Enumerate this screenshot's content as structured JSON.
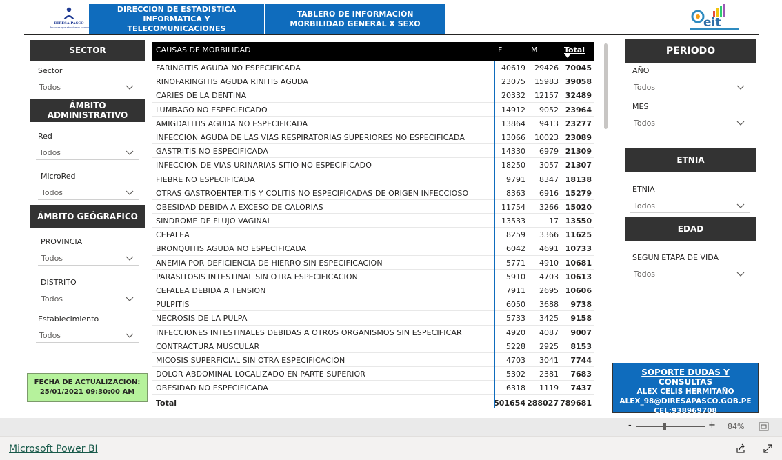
{
  "header": {
    "logo_left_name": "DIRESA PASCO",
    "logo_left_sub": "Personas que atendemos personas",
    "title_left_line1": "DIRECCION DE ESTADISTICA INFORMATICA Y",
    "title_left_line2": "TELECOMUNICACIONES",
    "title_right_line1": "TABLERO DE INFORMACIÓN",
    "title_right_line2": "MORBILIDAD GENERAL X SEXO",
    "logo_right_name": "eit"
  },
  "left_panel": {
    "sector_header": "SECTOR",
    "sector_label": "Sector",
    "sector_value": "Todos",
    "ambito_admin_header": "ÁMBITO ADMINISTRATIVO",
    "red_label": "Red",
    "red_value": "Todos",
    "microred_label": "MicroRed",
    "microred_value": "Todos",
    "ambito_geo_header": "ÁMBITO GEÓGRAFICO",
    "provincia_label": "PROVINCIA",
    "provincia_value": "Todos",
    "distrito_label": "DISTRITO",
    "distrito_value": "Todos",
    "establecimiento_label": "Establecimiento",
    "establecimiento_value": "Todos",
    "update_line1": "FECHA DE ACTUALIZACION:",
    "update_line2": "25/01/2021 09:30:00 AM"
  },
  "table": {
    "headers": [
      "CAUSAS DE MORBILIDAD",
      "F",
      "M",
      "Total"
    ],
    "rows": [
      [
        "FARINGITIS AGUDA NO ESPECIFICADA",
        "40619",
        "29426",
        "70045"
      ],
      [
        "RINOFARINGITIS AGUDA RINITIS AGUDA",
        "23075",
        "15983",
        "39058"
      ],
      [
        "CARIES DE LA DENTINA",
        "20332",
        "12157",
        "32489"
      ],
      [
        "LUMBAGO NO ESPECIFICADO",
        "14912",
        "9052",
        "23964"
      ],
      [
        "AMIGDALITIS AGUDA NO ESPECIFICADA",
        "13864",
        "9413",
        "23277"
      ],
      [
        "INFECCION AGUDA DE LAS VIAS RESPIRATORIAS SUPERIORES NO ESPECIFICADA",
        "13066",
        "10023",
        "23089"
      ],
      [
        "GASTRITIS NO ESPECIFICADA",
        "14330",
        "6979",
        "21309"
      ],
      [
        "INFECCION DE VIAS URINARIAS SITIO NO ESPECIFICADO",
        "18250",
        "3057",
        "21307"
      ],
      [
        "FIEBRE NO ESPECIFICADA",
        "9791",
        "8347",
        "18138"
      ],
      [
        "OTRAS GASTROENTERITIS Y COLITIS NO ESPECIFICADAS DE ORIGEN INFECCIOSO",
        "8363",
        "6916",
        "15279"
      ],
      [
        "OBESIDAD DEBIDA A EXCESO DE CALORIAS",
        "11754",
        "3266",
        "15020"
      ],
      [
        "SINDROME DE FLUJO VAGINAL",
        "13533",
        "17",
        "13550"
      ],
      [
        "CEFALEA",
        "8259",
        "3366",
        "11625"
      ],
      [
        "BRONQUITIS AGUDA NO ESPECIFICADA",
        "6042",
        "4691",
        "10733"
      ],
      [
        "ANEMIA POR DEFICIENCIA DE HIERRO SIN ESPECIFICACION",
        "5771",
        "4910",
        "10681"
      ],
      [
        "PARASITOSIS INTESTINAL SIN OTRA ESPECIFICACION",
        "5910",
        "4703",
        "10613"
      ],
      [
        "CEFALEA DEBIDA A TENSION",
        "7911",
        "2695",
        "10606"
      ],
      [
        "PULPITIS",
        "6050",
        "3688",
        "9738"
      ],
      [
        "NECROSIS DE LA PULPA",
        "5733",
        "3425",
        "9158"
      ],
      [
        "INFECCIONES INTESTINALES DEBIDAS A OTROS ORGANISMOS SIN ESPECIFICAR",
        "4920",
        "4087",
        "9007"
      ],
      [
        "CONTRACTURA MUSCULAR",
        "5228",
        "2925",
        "8153"
      ],
      [
        "MICOSIS SUPERFICIAL SIN OTRA ESPECIFICACION",
        "4703",
        "3041",
        "7744"
      ],
      [
        "DOLOR ABDOMINAL LOCALIZADO EN PARTE SUPERIOR",
        "5302",
        "2381",
        "7683"
      ],
      [
        "OBESIDAD NO ESPECIFICADA",
        "6318",
        "1119",
        "7437"
      ]
    ],
    "total_label": "Total",
    "total_f": "501654",
    "total_m": "288027",
    "total_total": "789681"
  },
  "right_panel": {
    "periodo_header": "PERIODO",
    "anio_label": "AÑO",
    "anio_value": "Todos",
    "mes_label": "MES",
    "mes_value": "Todos",
    "etnia_header": "ETNIA",
    "etnia_label": "ETNIA",
    "etnia_value": "Todos",
    "edad_header": "EDAD",
    "etapa_label": "SEGUN ETAPA DE VIDA",
    "etapa_value": "Todos",
    "support_title": "SOPORTE DUDAS Y CONSULTAS",
    "support_name": "ALEX CELIS HERMITAÑO",
    "support_email": "ALEX_98@DIRESAPASCO.GOB.PE",
    "support_phone": "CEL:938969708"
  },
  "zoom": {
    "minus": "-",
    "plus": "+",
    "level": "84%",
    "level_fraction": 0.84
  },
  "footer": {
    "link": "Microsoft Power BI"
  },
  "icons": [
    "chevron-down-icon",
    "fit-page-icon",
    "share-icon",
    "fullscreen-icon",
    "diresa-logo",
    "eit-logo"
  ],
  "colors": {
    "header_blue": "#0f6cbd",
    "dark_header": "#333333",
    "update_green": "#b6f29c",
    "table_header": "#000000"
  }
}
